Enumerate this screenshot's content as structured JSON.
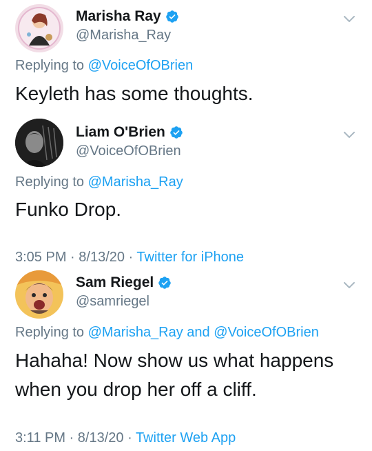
{
  "tweets": [
    {
      "name": "Marisha Ray",
      "handle": "@Marisha_Ray",
      "verified": true,
      "reply_prefix": "Replying to ",
      "reply_to": "@VoiceOfOBrien",
      "reply_and": "",
      "reply_to_2": "",
      "text": "Keyleth has some thoughts.",
      "time": "",
      "date": "",
      "source": ""
    },
    {
      "name": "Liam O'Brien",
      "handle": "@VoiceOfOBrien",
      "verified": true,
      "reply_prefix": "Replying to ",
      "reply_to": "@Marisha_Ray",
      "reply_and": "",
      "reply_to_2": "",
      "text": "Funko Drop.",
      "time": "3:05 PM",
      "date": "8/13/20",
      "source": "Twitter for iPhone"
    },
    {
      "name": "Sam Riegel",
      "handle": "@samriegel",
      "verified": true,
      "reply_prefix": "Replying to ",
      "reply_to": "@Marisha_Ray",
      "reply_and": " and ",
      "reply_to_2": "@VoiceOfOBrien",
      "text": "Hahaha! Now show us what happens when you drop her off a cliff.",
      "time": "3:11 PM",
      "date": "8/13/20",
      "source": "Twitter Web App"
    }
  ],
  "meta_separator": " · ",
  "colors": {
    "link": "#1da1f2",
    "secondary_text": "#657786",
    "primary_text": "#14171a",
    "verified_badge": "#1da1f2"
  },
  "icons": {
    "verified": "verified-badge-icon",
    "menu": "chevron-down-icon"
  }
}
